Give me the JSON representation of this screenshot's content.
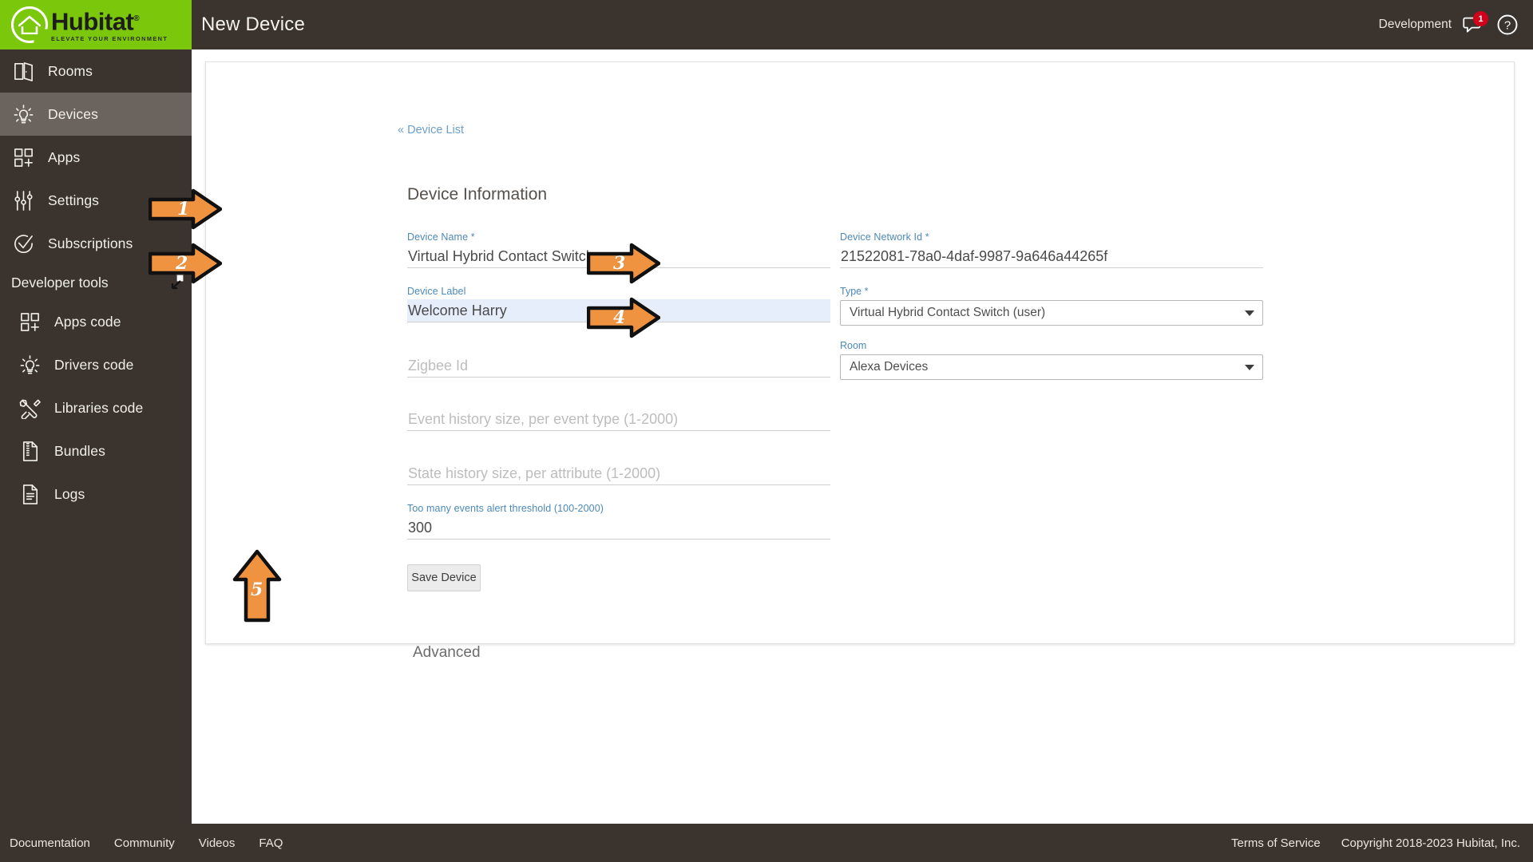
{
  "brand": {
    "name": "Hubitat",
    "tagline": "ELEVATE YOUR ENVIRONMENT",
    "green": "#7ac70c",
    "dark": "#3a332e"
  },
  "sidebar": {
    "items": [
      {
        "label": "Rooms",
        "icon": "door-icon",
        "active": false,
        "sub": false
      },
      {
        "label": "Devices",
        "icon": "bulb-icon",
        "active": true,
        "sub": false
      },
      {
        "label": "Apps",
        "icon": "apps-grid-icon",
        "active": false,
        "sub": false
      },
      {
        "label": "Settings",
        "icon": "sliders-icon",
        "active": false,
        "sub": false
      },
      {
        "label": "Subscriptions",
        "icon": "check-circle-icon",
        "active": false,
        "sub": false
      }
    ],
    "section_label": "Developer tools",
    "dev_items": [
      {
        "label": "Apps code",
        "icon": "apps-grid-icon"
      },
      {
        "label": "Drivers code",
        "icon": "bulb-icon"
      },
      {
        "label": "Libraries code",
        "icon": "tools-icon"
      },
      {
        "label": "Bundles",
        "icon": "zip-file-icon"
      },
      {
        "label": "Logs",
        "icon": "document-icon"
      }
    ]
  },
  "header": {
    "title": "New Device",
    "environment": "Development",
    "notification_count": "1",
    "chat_icon": "chat-bubble-icon",
    "help_icon": "question-circle-icon"
  },
  "main": {
    "back_link": "« Device List",
    "section_title": "Device Information",
    "fields": {
      "device_name": {
        "label": "Device Name *",
        "value": "Virtual Hybrid Contact Switch",
        "placeholder": ""
      },
      "network_id": {
        "label": "Device Network Id *",
        "value": "21522081-78a0-4daf-9987-9a646a44265f",
        "placeholder": ""
      },
      "device_label": {
        "label": "Device Label",
        "value": "Welcome Harry",
        "placeholder": ""
      },
      "type": {
        "label": "Type *",
        "value": "Virtual Hybrid Contact Switch (user)"
      },
      "zigbee_id": {
        "label": "",
        "value": "",
        "placeholder": "Zigbee Id"
      },
      "room": {
        "label": "Room",
        "value": "Alexa Devices"
      },
      "event_history": {
        "label": "",
        "value": "",
        "placeholder": "Event history size, per event type (1-2000)"
      },
      "state_history": {
        "label": "",
        "value": "",
        "placeholder": "State history size, per attribute (1-2000)"
      },
      "alert_threshold": {
        "label": "Too many events alert threshold (100-2000)",
        "value": "300",
        "placeholder": ""
      }
    },
    "save_button": "Save Device",
    "advanced": "Advanced"
  },
  "annotations": {
    "color": "#ef9340",
    "steps": [
      {
        "num": "1",
        "target": "device-name-field"
      },
      {
        "num": "2",
        "target": "device-label-field"
      },
      {
        "num": "3",
        "target": "type-select"
      },
      {
        "num": "4",
        "target": "room-select"
      },
      {
        "num": "5",
        "target": "save-device-button"
      }
    ]
  },
  "footer": {
    "links": [
      "Documentation",
      "Community",
      "Videos",
      "FAQ"
    ],
    "terms": "Terms of Service",
    "copyright": "Copyright 2018-2023 Hubitat, Inc."
  }
}
